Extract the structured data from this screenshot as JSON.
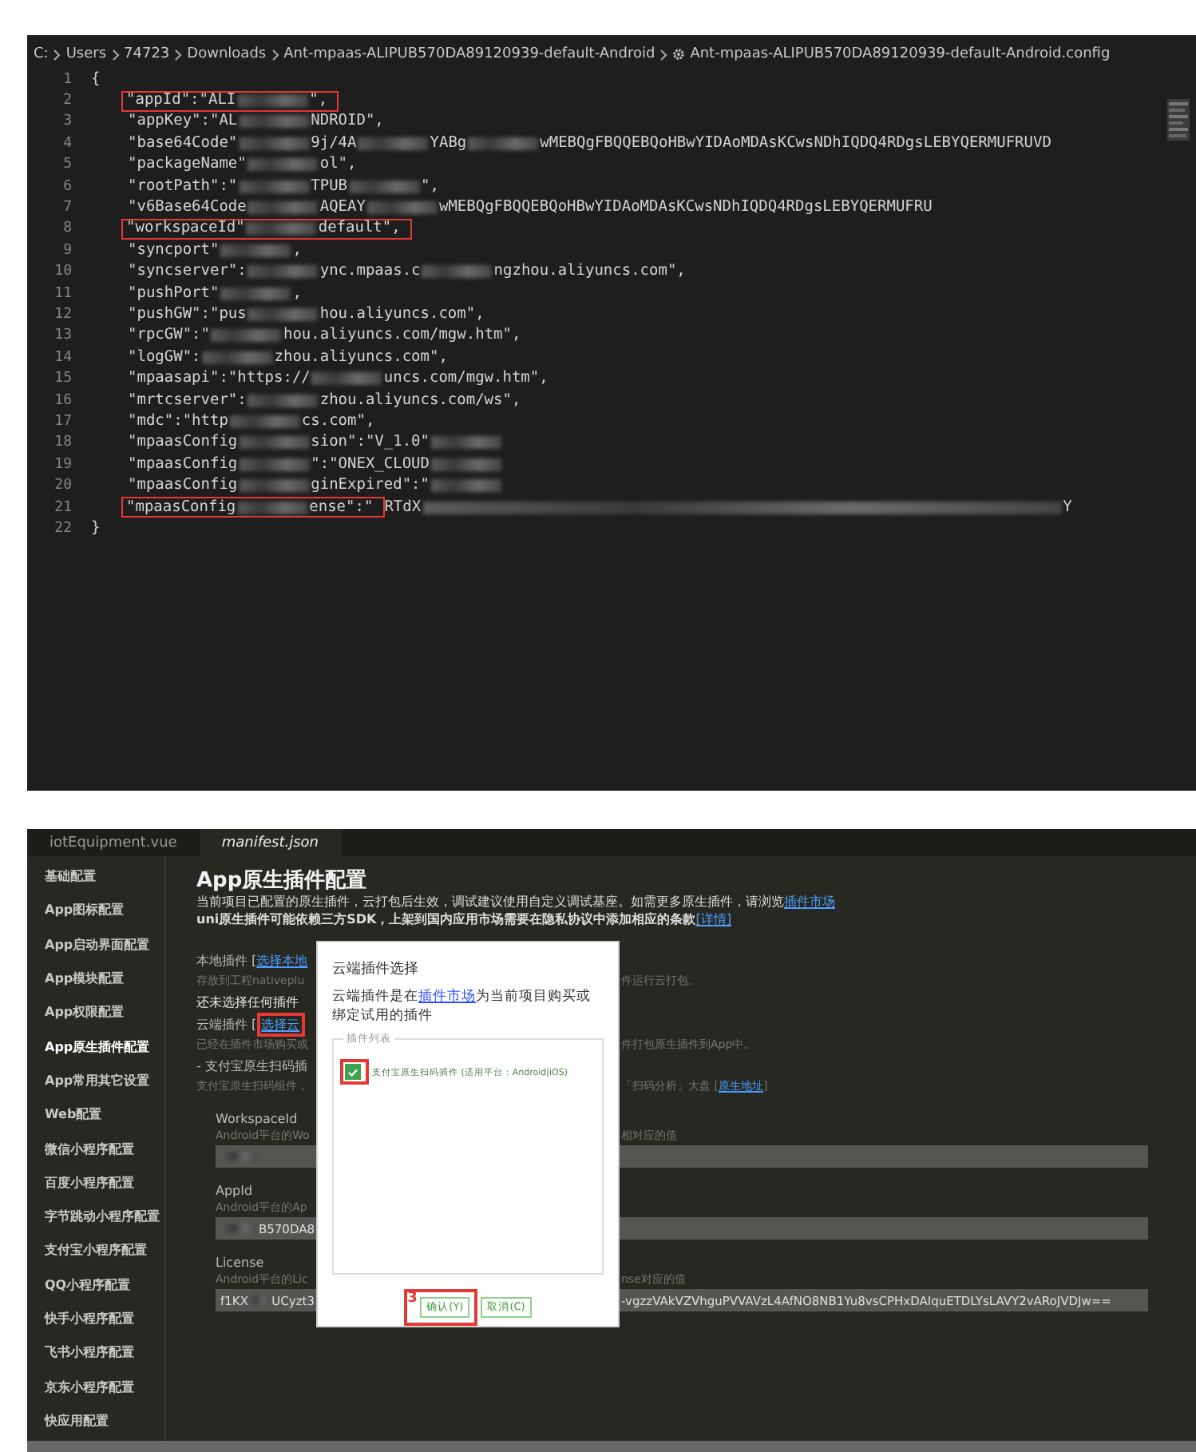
{
  "editor": {
    "breadcrumb": [
      {
        "text": "C:",
        "kind": "folder"
      },
      {
        "text": "Users",
        "kind": "folder"
      },
      {
        "text": "74723",
        "kind": "folder"
      },
      {
        "text": "Downloads",
        "kind": "folder"
      },
      {
        "text": "Ant-mpaas-ALIPUB570DA89120939-default-Android",
        "kind": "folder"
      },
      {
        "text": "Ant-mpaas-ALIPUB570DA89120939-default-Android.config",
        "kind": "file"
      }
    ],
    "lines": [
      {
        "number": "1",
        "kind": "brace",
        "parts": [
          {
            "kind": "text",
            "text": "{"
          }
        ]
      },
      {
        "number": "2",
        "kind": "entry",
        "parts": [
          {
            "kind": "box",
            "parts": [
              {
                "kind": "text",
                "text": "\"appId\":\"ALI"
              },
              {
                "kind": "blur"
              },
              {
                "kind": "text",
                "text": "\","
              }
            ]
          }
        ]
      },
      {
        "number": "3",
        "kind": "entry",
        "parts": [
          {
            "kind": "text",
            "text": "\"appKey\":\"AL"
          },
          {
            "kind": "blur"
          },
          {
            "kind": "text",
            "text": "NDROID\","
          }
        ]
      },
      {
        "number": "4",
        "kind": "entry",
        "parts": [
          {
            "kind": "text",
            "text": "\"base64Code\""
          },
          {
            "kind": "blur"
          },
          {
            "kind": "text",
            "text": "9j/4A"
          },
          {
            "kind": "blur"
          },
          {
            "kind": "text",
            "text": "YABg"
          },
          {
            "kind": "blur"
          },
          {
            "kind": "text",
            "text": "wMEBQgFBQQEBQoHBwYIDAoMDAsKCwsNDhIQDQ4RDgsLEBYQERMUFRUVD"
          }
        ]
      },
      {
        "number": "5",
        "kind": "entry",
        "parts": [
          {
            "kind": "text",
            "text": "\"packageName\""
          },
          {
            "kind": "blur"
          },
          {
            "kind": "text",
            "text": "ol\","
          }
        ]
      },
      {
        "number": "6",
        "kind": "entry",
        "parts": [
          {
            "kind": "text",
            "text": "\"rootPath\":\""
          },
          {
            "kind": "blur"
          },
          {
            "kind": "text",
            "text": "TPUB"
          },
          {
            "kind": "blur"
          },
          {
            "kind": "text",
            "text": "\","
          }
        ]
      },
      {
        "number": "7",
        "kind": "entry",
        "parts": [
          {
            "kind": "text",
            "text": "\"v6Base64Code"
          },
          {
            "kind": "blur"
          },
          {
            "kind": "text",
            "text": "AQEAY"
          },
          {
            "kind": "blur"
          },
          {
            "kind": "text",
            "text": "wMEBQgFBQQEBQoHBwYIDAoMDAsKCwsNDhIQDQ4RDgsLEBYQERMUFRU"
          }
        ]
      },
      {
        "number": "8",
        "kind": "entry",
        "parts": [
          {
            "kind": "box",
            "parts": [
              {
                "kind": "text",
                "text": "\"workspaceId\""
              },
              {
                "kind": "blur"
              },
              {
                "kind": "text",
                "text": "default\","
              }
            ]
          }
        ]
      },
      {
        "number": "9",
        "kind": "entry",
        "parts": [
          {
            "kind": "text",
            "text": "\"syncport\""
          },
          {
            "kind": "blur"
          },
          {
            "kind": "text",
            "text": ","
          }
        ]
      },
      {
        "number": "10",
        "kind": "entry",
        "parts": [
          {
            "kind": "text",
            "text": "\"syncserver\":"
          },
          {
            "kind": "blur"
          },
          {
            "kind": "text",
            "text": "ync.mpaas.c"
          },
          {
            "kind": "blur"
          },
          {
            "kind": "text",
            "text": "ngzhou.aliyuncs.com\","
          }
        ]
      },
      {
        "number": "11",
        "kind": "entry",
        "parts": [
          {
            "kind": "text",
            "text": "\"pushPort\""
          },
          {
            "kind": "blur"
          },
          {
            "kind": "text",
            "text": ","
          }
        ]
      },
      {
        "number": "12",
        "kind": "entry",
        "parts": [
          {
            "kind": "text",
            "text": "\"pushGW\":\"pus"
          },
          {
            "kind": "blur"
          },
          {
            "kind": "text",
            "text": "hou.aliyuncs.com\","
          }
        ]
      },
      {
        "number": "13",
        "kind": "entry",
        "parts": [
          {
            "kind": "text",
            "text": "\"rpcGW\":\""
          },
          {
            "kind": "blur"
          },
          {
            "kind": "text",
            "text": "hou.aliyuncs.com/mgw.htm\","
          }
        ]
      },
      {
        "number": "14",
        "kind": "entry",
        "parts": [
          {
            "kind": "text",
            "text": "\"logGW\":"
          },
          {
            "kind": "blur"
          },
          {
            "kind": "text",
            "text": "zhou.aliyuncs.com\","
          }
        ]
      },
      {
        "number": "15",
        "kind": "entry",
        "parts": [
          {
            "kind": "text",
            "text": "\"mpaasapi\":\"https://"
          },
          {
            "kind": "blur"
          },
          {
            "kind": "text",
            "text": "uncs.com/mgw.htm\","
          }
        ]
      },
      {
        "number": "16",
        "kind": "entry",
        "parts": [
          {
            "kind": "text",
            "text": "\"mrtcserver\":"
          },
          {
            "kind": "blur"
          },
          {
            "kind": "text",
            "text": "zhou.aliyuncs.com/ws\","
          }
        ]
      },
      {
        "number": "17",
        "kind": "entry",
        "parts": [
          {
            "kind": "text",
            "text": "\"mdc\":\"http"
          },
          {
            "kind": "blur"
          },
          {
            "kind": "text",
            "text": "cs.com\","
          }
        ]
      },
      {
        "number": "18",
        "kind": "entry",
        "parts": [
          {
            "kind": "text",
            "text": "\"mpaasConfig"
          },
          {
            "kind": "blur"
          },
          {
            "kind": "text",
            "text": "sion\":\"V_1.0\""
          },
          {
            "kind": "blur"
          }
        ]
      },
      {
        "number": "19",
        "kind": "entry",
        "parts": [
          {
            "kind": "text",
            "text": "\"mpaasConfig"
          },
          {
            "kind": "blur"
          },
          {
            "kind": "text",
            "text": "\":\"ONEX_CLOUD"
          },
          {
            "kind": "blur"
          }
        ]
      },
      {
        "number": "20",
        "kind": "entry",
        "parts": [
          {
            "kind": "text",
            "text": "\"mpaasConfig"
          },
          {
            "kind": "blur"
          },
          {
            "kind": "text",
            "text": "ginExpired\":\""
          },
          {
            "kind": "blur"
          }
        ]
      },
      {
        "number": "21",
        "kind": "entry",
        "parts": [
          {
            "kind": "box",
            "parts": [
              {
                "kind": "text",
                "text": "\"mpaasConfig"
              },
              {
                "kind": "blur"
              },
              {
                "kind": "text",
                "text": "ense\":\""
              }
            ]
          },
          {
            "kind": "text",
            "text": "RTdX"
          },
          {
            "kind": "blur-long"
          },
          {
            "kind": "text",
            "text": "Y"
          }
        ]
      },
      {
        "number": "22",
        "kind": "brace",
        "parts": [
          {
            "kind": "text",
            "text": "}"
          }
        ]
      }
    ]
  },
  "ide": {
    "tabs": [
      {
        "label": "iotEquipment.vue",
        "selected": false
      },
      {
        "label": "manifest.json",
        "selected": true
      }
    ],
    "sidebar": [
      {
        "label": "基础配置",
        "selected": false
      },
      {
        "label": "App图标配置",
        "selected": false
      },
      {
        "label": "App启动界面配置",
        "selected": false
      },
      {
        "label": "App模块配置",
        "selected": false
      },
      {
        "label": "App权限配置",
        "selected": false
      },
      {
        "label": "App原生插件配置",
        "selected": true
      },
      {
        "label": "App常用其它设置",
        "selected": false
      },
      {
        "label": "Web配置",
        "selected": false
      },
      {
        "label": "微信小程序配置",
        "selected": false
      },
      {
        "label": "百度小程序配置",
        "selected": false
      },
      {
        "label": "字节跳动小程序配置",
        "selected": false
      },
      {
        "label": "支付宝小程序配置",
        "selected": false
      },
      {
        "label": "QQ小程序配置",
        "selected": false
      },
      {
        "label": "快手小程序配置",
        "selected": false
      },
      {
        "label": "飞书小程序配置",
        "selected": false
      },
      {
        "label": "京东小程序配置",
        "selected": false
      },
      {
        "label": "快应用配置",
        "selected": false
      }
    ],
    "title": "App原生插件配置",
    "description": [
      {
        "text": "当前项目已配置的原生插件，云打包后生效，调试建议使用自定义调试基座。如需更多原生插件，请浏览",
        "link": "插件市场",
        "bold": false
      },
      {
        "text": "uni原生插件可能依赖三方SDK，上架到国内应用市场需要在隐私协议中添加相应的条款",
        "link": "[详情]",
        "bold": true
      }
    ],
    "rows": [
      {
        "kind": "heading",
        "left": [
          {
            "kind": "text",
            "text": "本地插件 ["
          },
          {
            "kind": "link",
            "text": "选择本地"
          }
        ]
      },
      {
        "kind": "hint",
        "left": [
          {
            "kind": "text",
            "text": "存放到工程nativeplu"
          }
        ],
        "right": [
          {
            "kind": "text",
            "text": "件运行云打包。"
          }
        ]
      },
      {
        "kind": "plain",
        "left": [
          {
            "kind": "text",
            "text": "还未选择任何插件"
          }
        ]
      },
      {
        "kind": "heading",
        "left": [
          {
            "kind": "text",
            "text": "云端插件 ["
          },
          {
            "kind": "boxed-link",
            "text": "选择云"
          }
        ]
      },
      {
        "kind": "hint",
        "left": [
          {
            "kind": "text",
            "text": "已经在插件市场购买或"
          }
        ],
        "right": [
          {
            "kind": "text",
            "text": "件打包原生插件到App中。"
          }
        ]
      },
      {
        "kind": "heading",
        "left": [
          {
            "kind": "text",
            "text": "- 支付宝原生扫码插"
          }
        ]
      },
      {
        "kind": "hint",
        "left": [
          {
            "kind": "text",
            "text": "支付宝原生扫码组件，"
          }
        ],
        "right": [
          {
            "kind": "text",
            "text": "「扫码分析」大盘 ["
          },
          {
            "kind": "link",
            "text": "原生地址"
          },
          {
            "kind": "text",
            "text": "]"
          }
        ]
      },
      {
        "kind": "label",
        "left": [
          {
            "kind": "text",
            "text": "WorkspaceId"
          }
        ]
      },
      {
        "kind": "sub-hint",
        "left": [
          {
            "kind": "text",
            "text": "Android平台的Wo"
          }
        ],
        "right": [
          {
            "kind": "text",
            "text": "相对应的值"
          }
        ]
      },
      {
        "kind": "field",
        "left": [
          {
            "kind": "blur"
          }
        ]
      },
      {
        "kind": "label",
        "left": [
          {
            "kind": "text",
            "text": "AppId"
          }
        ]
      },
      {
        "kind": "sub-hint",
        "left": [
          {
            "kind": "text",
            "text": "Android平台的Ap"
          }
        ]
      },
      {
        "kind": "field",
        "left": [
          {
            "kind": "blur"
          },
          {
            "kind": "text",
            "text": "B570DA8"
          }
        ]
      },
      {
        "kind": "label",
        "left": [
          {
            "kind": "text",
            "text": "License"
          }
        ]
      },
      {
        "kind": "sub-hint",
        "left": [
          {
            "kind": "text",
            "text": "Android平台的Lic"
          }
        ],
        "right": [
          {
            "kind": "text",
            "text": "nse对应的值"
          }
        ]
      },
      {
        "kind": "field",
        "left": [
          {
            "kind": "text",
            "text": "f1KX"
          },
          {
            "kind": "blur"
          },
          {
            "kind": "text",
            "text": "UCyzt3"
          }
        ],
        "right": [
          {
            "kind": "text",
            "text": "-vgzzVAkVZVhguPVVAVzL4AfNO8NB1Yu8vsCPHxDAIquETDLYsLAVY2vARoJVDJw=="
          }
        ]
      }
    ],
    "dialog": {
      "title": "云端插件选择",
      "text_before": "云端插件是在",
      "link": "插件市场",
      "text_after": "为当前项目购买或绑定试用的插件",
      "legend": "插件列表",
      "plugins": [
        {
          "label": "支付宝原生扫码插件 (适用平台：Android|iOS)",
          "checked": true,
          "boxed": true
        }
      ],
      "buttons": [
        {
          "label": "确认(Y)",
          "boxed": true,
          "annotation": "3"
        },
        {
          "label": "取消(C)",
          "boxed": false
        }
      ]
    }
  }
}
